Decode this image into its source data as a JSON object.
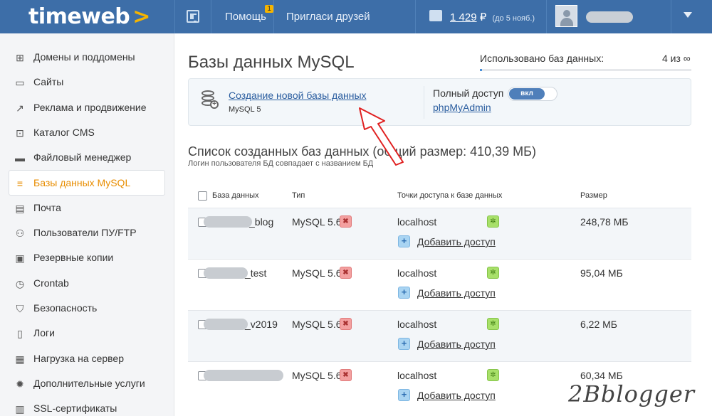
{
  "topbar": {
    "logo": "timeweb",
    "logo_arrow": ">",
    "help_label": "Помощь",
    "help_badge": "1",
    "invite_label": "Пригласи друзей",
    "balance_amount": "1 429",
    "balance_currency": "₽",
    "balance_until": "(до 5 нояб.)"
  },
  "sidebar": {
    "items": [
      {
        "label": "Домены и поддомены",
        "icon": "sitemap-icon"
      },
      {
        "label": "Сайты",
        "icon": "page-icon"
      },
      {
        "label": "Реклама и продвижение",
        "icon": "chart-icon"
      },
      {
        "label": "Каталог CMS",
        "icon": "cart-icon"
      },
      {
        "label": "Файловый менеджер",
        "icon": "folder-icon"
      },
      {
        "label": "Базы данных MySQL",
        "icon": "database-icon",
        "active": true
      },
      {
        "label": "Почта",
        "icon": "mail-icon"
      },
      {
        "label": "Пользователи ПУ/FTP",
        "icon": "users-icon"
      },
      {
        "label": "Резервные копии",
        "icon": "backup-icon"
      },
      {
        "label": "Crontab",
        "icon": "clock-icon"
      },
      {
        "label": "Безопасность",
        "icon": "shield-icon"
      },
      {
        "label": "Логи",
        "icon": "log-icon"
      },
      {
        "label": "Нагрузка на сервер",
        "icon": "load-icon"
      },
      {
        "label": "Дополнительные услуги",
        "icon": "badge-icon"
      },
      {
        "label": "SSL-сертификаты",
        "icon": "ssl-icon"
      }
    ]
  },
  "main": {
    "title": "Базы данных MySQL",
    "usage_label": "Использовано баз данных:",
    "usage_value": "4 из ∞",
    "usage_fraction": 0.01,
    "create_link": "Создание новой базы данных",
    "create_sub": "MySQL 5",
    "full_access_label": "Полный доступ",
    "toggle_label": "вкл",
    "pma_link": "phpMyAdmin",
    "list_title": "Список созданных баз данных (общий размер: 410,39 МБ)",
    "list_sub": "Логин пользователя БД совпадает с названием БД"
  },
  "table": {
    "headers": {
      "name": "База данных",
      "type": "Тип",
      "access": "Точки доступа к базе данных",
      "size": "Размер"
    },
    "rows": [
      {
        "name_suffix": "_blog",
        "type": "MySQL 5.6",
        "host": "localhost",
        "add_access": "Добавить доступ",
        "size": "248,78 МБ"
      },
      {
        "name_suffix": "_test",
        "type": "MySQL 5.6",
        "host": "localhost",
        "add_access": "Добавить доступ",
        "size": "95,04 МБ"
      },
      {
        "name_suffix": "_v2019",
        "type": "MySQL 5.6",
        "host": "localhost",
        "add_access": "Добавить доступ",
        "size": "6,22 МБ"
      },
      {
        "name_suffix": "",
        "type": "MySQL 5.6",
        "host": "localhost",
        "add_access": "Добавить доступ",
        "size": "60,34 МБ"
      }
    ]
  },
  "watermark": "2Bblogger"
}
